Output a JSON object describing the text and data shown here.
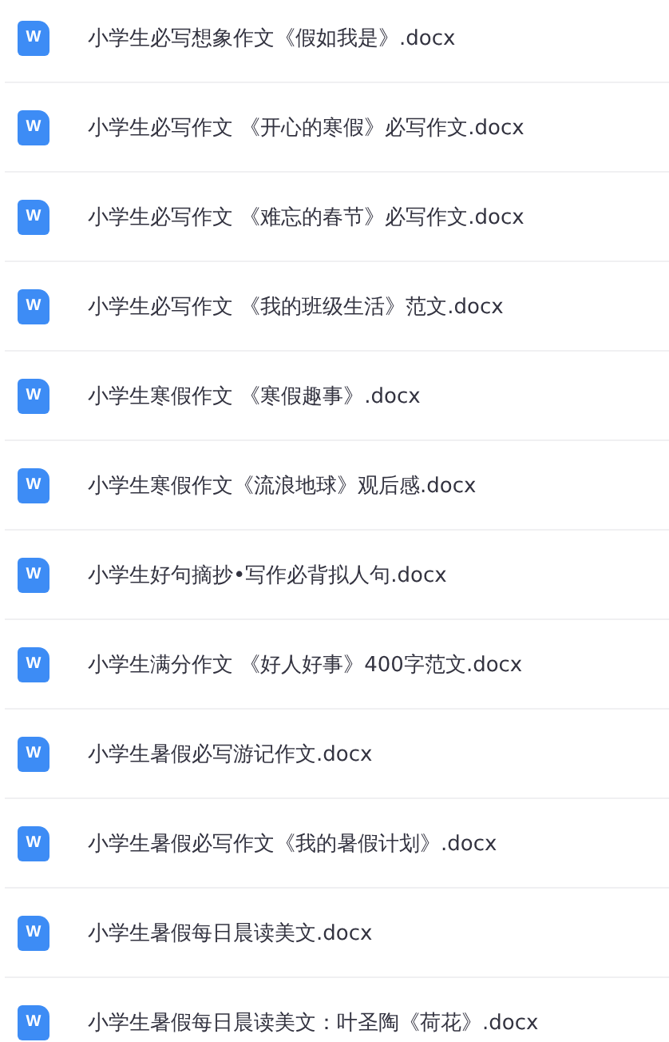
{
  "files": [
    {
      "name": "小学生必写想象作文《假如我是》.docx",
      "icon_label": "W"
    },
    {
      "name": "小学生必写作文 《开心的寒假》必写作文.docx",
      "icon_label": "W"
    },
    {
      "name": "小学生必写作文 《难忘的春节》必写作文.docx",
      "icon_label": "W"
    },
    {
      "name": "小学生必写作文 《我的班级生活》范文.docx",
      "icon_label": "W"
    },
    {
      "name": "小学生寒假作文 《寒假趣事》.docx",
      "icon_label": "W"
    },
    {
      "name": "小学生寒假作文《流浪地球》观后感.docx",
      "icon_label": "W"
    },
    {
      "name": "小学生好句摘抄•写作必背拟人句.docx",
      "icon_label": "W"
    },
    {
      "name": "小学生满分作文 《好人好事》400字范文.docx",
      "icon_label": "W"
    },
    {
      "name": "小学生暑假必写游记作文.docx",
      "icon_label": "W"
    },
    {
      "name": "小学生暑假必写作文《我的暑假计划》.docx",
      "icon_label": "W"
    },
    {
      "name": "小学生暑假每日晨读美文.docx",
      "icon_label": "W"
    },
    {
      "name": "小学生暑假每日晨读美文：叶圣陶《荷花》.docx",
      "icon_label": "W"
    }
  ]
}
